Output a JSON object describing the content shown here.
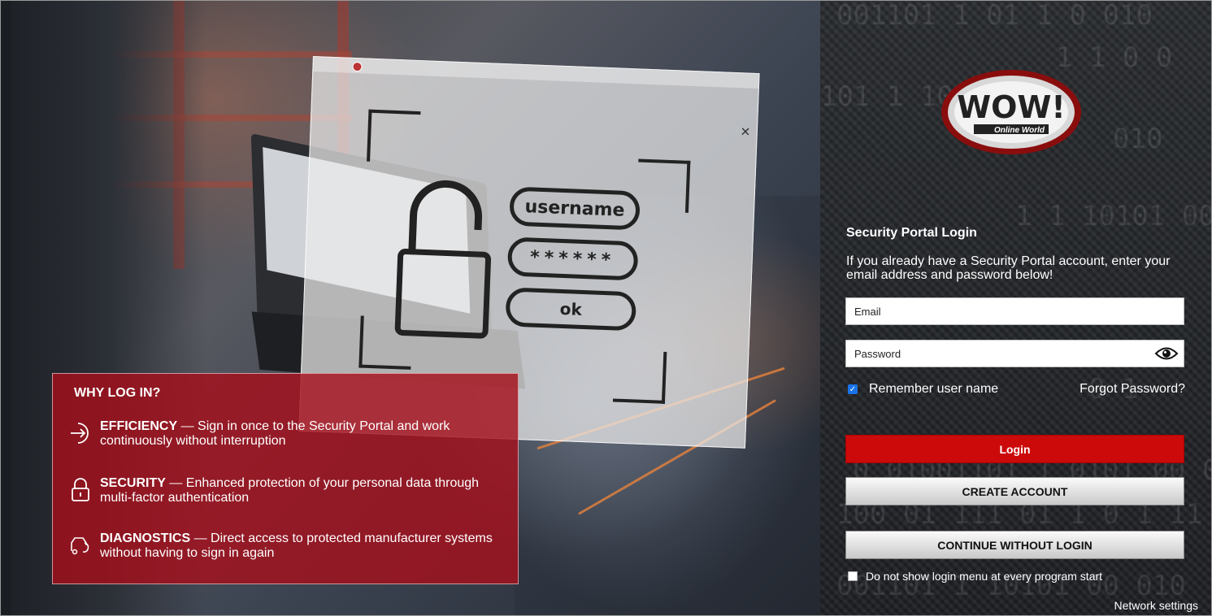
{
  "hero": {
    "dialog": {
      "close_glyph": "×",
      "username_label": "username",
      "password_mask": "******",
      "ok_label": "ok"
    },
    "why": {
      "title": "WHY LOG IN?",
      "items": [
        {
          "icon": "sign-in-arrow-icon",
          "heading": "EFFICIENCY",
          "text": " — Sign in once to the Security Portal and work continuously without interruption"
        },
        {
          "icon": "padlock-icon",
          "heading": "SECURITY",
          "text": " — Enhanced protection of your personal data through multi-factor authentication"
        },
        {
          "icon": "car-diagnostics-icon",
          "heading": "DIAGNOSTICS",
          "text": " — Direct access to protected manufacturer systems without having to sign in again"
        }
      ]
    }
  },
  "panel": {
    "logo": {
      "main": "WOW!",
      "sub": "Online World"
    },
    "binary": [
      "001101 1 01 1 0 010",
      "1 1 0 0",
      "101 1 10 01 1",
      "010",
      "1 1 10101 00 010",
      "0 1",
      "0 01001101 1 0101 00 01",
      "100 01 111 01 1 0 1 11",
      "001101 1 10101 00 010"
    ],
    "title": "Security Portal Login",
    "subtitle": "If you already have a Security Portal account, enter your email address and password below!",
    "email_placeholder": "Email",
    "password_placeholder": "Password",
    "remember_label": "Remember user name",
    "remember_checked": true,
    "forgot_label": "Forgot Password?",
    "login_label": "Login",
    "create_label": "CREATE ACCOUNT",
    "continue_label": "CONTINUE WITHOUT LOGIN",
    "noshow_label": "Do not show login menu at every program start",
    "noshow_checked": false,
    "network_label": "Network settings",
    "colors": {
      "login": "#cc0a0a",
      "why_box": "#a5101c",
      "checkbox": "#1a73e8"
    }
  }
}
